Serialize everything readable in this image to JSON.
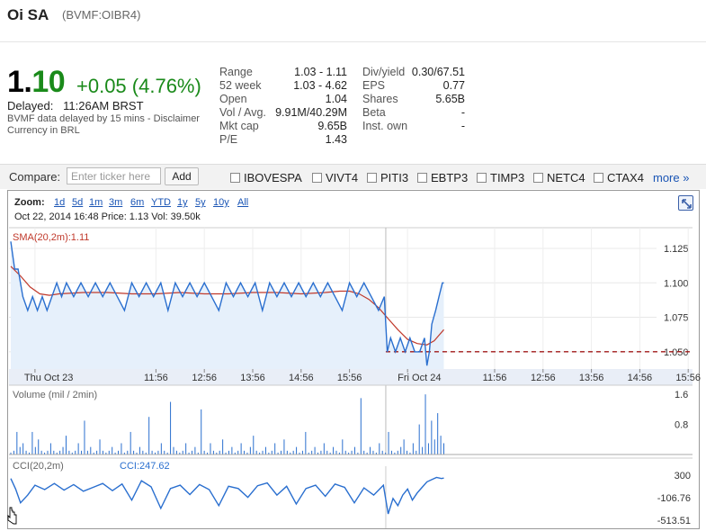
{
  "header": {
    "name": "Oi SA",
    "symbol": "(BVMF:OIBR4)"
  },
  "quote": {
    "price_int": "1.",
    "price_dec": "10",
    "change": "+0.05 (4.76%)",
    "delayed_label": "Delayed:",
    "delayed_time": "11:26AM BRST",
    "disclaimer_line1": "BVMF data delayed by 15 mins - Disclaimer",
    "disclaimer_line2": "Currency in BRL"
  },
  "stats_left": [
    {
      "label": "Range",
      "value": "1.03 - 1.11"
    },
    {
      "label": "52 week",
      "value": "1.03 - 4.62"
    },
    {
      "label": "Open",
      "value": "1.04"
    },
    {
      "label": "Vol / Avg.",
      "value": "9.91M/40.29M"
    },
    {
      "label": "Mkt cap",
      "value": "9.65B"
    },
    {
      "label": "P/E",
      "value": "1.43"
    }
  ],
  "stats_right": [
    {
      "label": "Div/yield",
      "value": "0.30/67.51"
    },
    {
      "label": "EPS",
      "value": "0.77"
    },
    {
      "label": "Shares",
      "value": "5.65B"
    },
    {
      "label": "Beta",
      "value": "-"
    },
    {
      "label": "Inst. own",
      "value": "-"
    }
  ],
  "compare": {
    "label": "Compare:",
    "placeholder": "Enter ticker here",
    "button": "Add",
    "tickers": [
      "IBOVESPA",
      "VIVT4",
      "PITI3",
      "EBTP3",
      "TIMP3",
      "NETC4",
      "CTAX4"
    ],
    "more": "more »"
  },
  "zoom": {
    "label": "Zoom:",
    "options": [
      "1d",
      "5d",
      "1m",
      "3m",
      "6m",
      "YTD",
      "1y",
      "5y",
      "10y",
      "All"
    ]
  },
  "info_line": "Oct 22, 2014 16:48 Price: 1.13 Vol: 39.50k",
  "colors": {
    "price_line": "#2a6fcf",
    "sma_line": "#c0392b",
    "area": "#e6f0fb",
    "volume": "#2a6fcf",
    "ref_line": "#a01818",
    "change": "#1a8a1a"
  },
  "chart_data": [
    {
      "type": "line",
      "title": "",
      "indicator_label": "SMA(20,2m):1.11",
      "y_ticks": [
        "1.125",
        "1.100",
        "1.075",
        "1.050"
      ],
      "ylim": [
        1.0375,
        1.14
      ],
      "x_ticks": [
        "Thu Oct 23",
        "11:56",
        "12:56",
        "13:56",
        "14:56",
        "15:56",
        "Fri Oct 24",
        "11:56",
        "12:56",
        "13:56",
        "14:56",
        "15:56"
      ],
      "x_tick_slots": [
        0.5,
        3,
        4,
        5,
        6,
        7,
        8.2,
        10,
        11,
        12,
        13,
        14
      ],
      "session_break_slot": 7.75,
      "last_slot": 8.95,
      "reference_close": 1.05,
      "series": [
        {
          "name": "",
          "x": [
            0,
            0.08,
            0.15,
            0.25,
            0.35,
            0.45,
            0.55,
            0.65,
            0.75,
            0.85,
            0.95,
            1.05,
            1.15,
            1.3,
            1.45,
            1.6,
            1.75,
            1.9,
            2.05,
            2.2,
            2.35,
            2.5,
            2.65,
            2.8,
            2.95,
            3.1,
            3.25,
            3.4,
            3.55,
            3.7,
            3.85,
            4.0,
            4.15,
            4.3,
            4.45,
            4.6,
            4.75,
            4.9,
            5.05,
            5.2,
            5.35,
            5.5,
            5.65,
            5.8,
            5.95,
            6.1,
            6.25,
            6.4,
            6.55,
            6.7,
            6.85,
            7.0,
            7.15,
            7.3,
            7.45,
            7.6,
            7.72,
            7.78,
            7.85,
            7.95,
            8.05,
            8.15,
            8.25,
            8.35,
            8.45,
            8.55,
            8.6,
            8.65,
            8.7,
            8.78,
            8.85,
            8.92,
            8.95
          ],
          "values": [
            1.13,
            1.11,
            1.11,
            1.09,
            1.08,
            1.09,
            1.08,
            1.09,
            1.08,
            1.09,
            1.1,
            1.09,
            1.1,
            1.09,
            1.1,
            1.09,
            1.1,
            1.09,
            1.1,
            1.09,
            1.08,
            1.1,
            1.09,
            1.1,
            1.09,
            1.1,
            1.08,
            1.1,
            1.09,
            1.1,
            1.09,
            1.1,
            1.09,
            1.08,
            1.1,
            1.09,
            1.1,
            1.09,
            1.1,
            1.08,
            1.1,
            1.09,
            1.1,
            1.09,
            1.1,
            1.09,
            1.1,
            1.09,
            1.1,
            1.09,
            1.08,
            1.1,
            1.09,
            1.1,
            1.09,
            1.08,
            1.09,
            1.05,
            1.06,
            1.05,
            1.06,
            1.05,
            1.06,
            1.05,
            1.05,
            1.06,
            1.04,
            1.05,
            1.07,
            1.08,
            1.09,
            1.1,
            1.1
          ]
        },
        {
          "name": "SMA(20,2m)",
          "x": [
            0,
            0.2,
            0.4,
            0.6,
            0.8,
            1.0,
            1.5,
            2.0,
            2.5,
            3.0,
            3.5,
            4.0,
            4.5,
            5.0,
            5.5,
            6.0,
            6.5,
            6.8,
            7.0,
            7.2,
            7.4,
            7.6,
            7.8,
            8.0,
            8.2,
            8.4,
            8.6,
            8.75,
            8.85,
            8.95
          ],
          "values": [
            1.112,
            1.105,
            1.097,
            1.092,
            1.091,
            1.092,
            1.093,
            1.093,
            1.092,
            1.092,
            1.093,
            1.092,
            1.092,
            1.093,
            1.093,
            1.092,
            1.093,
            1.094,
            1.094,
            1.092,
            1.088,
            1.082,
            1.074,
            1.066,
            1.059,
            1.056,
            1.055,
            1.058,
            1.062,
            1.066
          ]
        }
      ]
    },
    {
      "type": "bar",
      "title": "",
      "indicator_label": "Volume (mil / 2min)",
      "y_ticks": [
        "1.6",
        "0.8"
      ],
      "ylim": [
        0,
        1.7
      ],
      "values": [
        0.05,
        0.1,
        0.6,
        0.2,
        0.3,
        0.1,
        0.05,
        0.6,
        0.2,
        0.4,
        0.1,
        0.05,
        0.1,
        0.3,
        0.1,
        0.05,
        0.1,
        0.2,
        0.5,
        0.1,
        0.05,
        0.1,
        0.3,
        0.1,
        0.9,
        0.1,
        0.2,
        0.05,
        0.1,
        0.4,
        0.1,
        0.05,
        0.1,
        0.2,
        0.05,
        0.1,
        0.3,
        0.05,
        0.1,
        0.6,
        0.1,
        0.05,
        0.2,
        0.1,
        0.05,
        1.0,
        0.1,
        0.05,
        0.1,
        0.3,
        0.1,
        0.05,
        1.4,
        0.2,
        0.1,
        0.05,
        0.1,
        0.3,
        0.05,
        0.1,
        0.2,
        0.05,
        1.2,
        0.1,
        0.05,
        0.3,
        0.1,
        0.05,
        0.1,
        0.4,
        0.05,
        0.1,
        0.2,
        0.05,
        0.1,
        0.3,
        0.1,
        0.05,
        0.2,
        0.5,
        0.1,
        0.05,
        0.1,
        0.2,
        0.05,
        0.1,
        0.3,
        0.05,
        0.1,
        0.4,
        0.1,
        0.05,
        0.1,
        0.2,
        0.05,
        0.1,
        0.6,
        0.05,
        0.1,
        0.2,
        0.05,
        0.1,
        0.3,
        0.1,
        0.05,
        0.2,
        0.1,
        0.05,
        0.4,
        0.1,
        0.05,
        0.1,
        0.2,
        0.05,
        1.5,
        0.1,
        0.05,
        0.2,
        0.1,
        0.05,
        0.3,
        0.1,
        0.05,
        0.6,
        0.1,
        0.05,
        0.1,
        0.2,
        0.4,
        0.1,
        0.05,
        0.3,
        0.1,
        0.8,
        0.2,
        1.6,
        0.3,
        0.9,
        0.4,
        1.1,
        0.5,
        0.3
      ]
    },
    {
      "type": "line",
      "title": "",
      "indicator_label": "CCI(20,2m)",
      "value_label": "CCI:247.62",
      "y_ticks": [
        "300",
        "-106.76",
        "-513.51"
      ],
      "ylim": [
        -513.51,
        300
      ],
      "series": [
        {
          "name": "",
          "x": [
            0,
            0.1,
            0.2,
            0.35,
            0.5,
            0.7,
            0.9,
            1.1,
            1.3,
            1.5,
            1.7,
            1.9,
            2.1,
            2.3,
            2.5,
            2.7,
            2.9,
            3.1,
            3.3,
            3.5,
            3.7,
            3.9,
            4.1,
            4.3,
            4.5,
            4.7,
            4.9,
            5.1,
            5.3,
            5.5,
            5.7,
            5.9,
            6.1,
            6.3,
            6.5,
            6.7,
            6.9,
            7.1,
            7.3,
            7.5,
            7.7,
            7.8,
            7.9,
            8.0,
            8.1,
            8.2,
            8.3,
            8.4,
            8.5,
            8.6,
            8.7,
            8.8,
            8.9,
            8.95
          ],
          "values": [
            240,
            50,
            -200,
            -60,
            120,
            40,
            150,
            30,
            130,
            10,
            80,
            150,
            20,
            140,
            -150,
            200,
            90,
            -300,
            60,
            120,
            -50,
            130,
            40,
            -250,
            100,
            60,
            -100,
            110,
            160,
            -60,
            100,
            -220,
            60,
            120,
            -80,
            140,
            80,
            -200,
            70,
            -60,
            120,
            -400,
            -120,
            -250,
            -60,
            50,
            -150,
            -20,
            80,
            180,
            220,
            260,
            240,
            247.62
          ]
        }
      ]
    }
  ]
}
